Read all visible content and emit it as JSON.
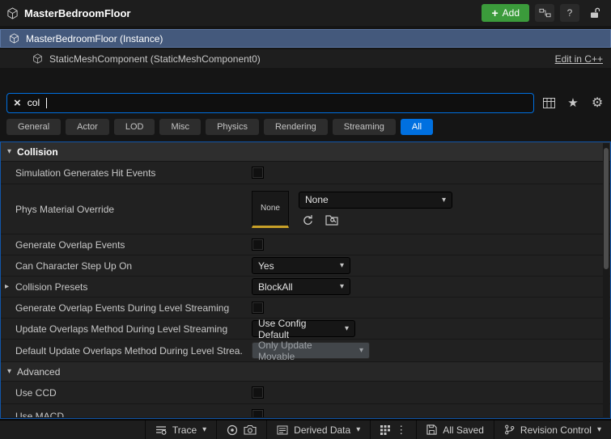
{
  "colors": {
    "accent_blue": "#0070e0",
    "add_green": "#3b9b3b",
    "selection_blue": "#44597c",
    "thumb_underline": "#c8a028"
  },
  "topbar": {
    "title": "MasterBedroomFloor",
    "add_label": "Add",
    "help_label": "?"
  },
  "tree": {
    "instance_label": "MasterBedroomFloor (Instance)",
    "component_label": "StaticMeshComponent (StaticMeshComponent0)",
    "edit_cpp_label": "Edit in C++"
  },
  "search": {
    "value": "col"
  },
  "tabs": {
    "items": [
      "General",
      "Actor",
      "LOD",
      "Misc",
      "Physics",
      "Rendering",
      "Streaming",
      "All"
    ],
    "active": "All"
  },
  "details": {
    "collision_header": "Collision",
    "advanced_header": "Advanced",
    "rows": [
      {
        "label": "Simulation Generates Hit Events",
        "control": "checkbox",
        "checked": false
      },
      {
        "label": "Phys Material Override",
        "control": "asset",
        "thumb_text": "None",
        "value": "None"
      },
      {
        "label": "Generate Overlap Events",
        "control": "checkbox",
        "checked": false
      },
      {
        "label": "Can Character Step Up On",
        "control": "dropdown",
        "value": "Yes"
      },
      {
        "label": "Collision Presets",
        "control": "dropdown",
        "value": "BlockAll"
      },
      {
        "label": "Generate Overlap Events During Level Streaming",
        "control": "checkbox",
        "checked": false
      },
      {
        "label": "Update Overlaps Method During Level Streaming",
        "control": "dropdown",
        "value": "Use Config Default"
      },
      {
        "label": "Default Update Overlaps Method During Level Strea...",
        "control": "dropdown",
        "value": "Only Update Movable",
        "disabled": true
      },
      {
        "label": "Use CCD",
        "control": "checkbox",
        "checked": false
      },
      {
        "label": "Use MACD",
        "control": "checkbox",
        "partial": true
      }
    ]
  },
  "statusbar": {
    "trace_label": "Trace",
    "derived_data_label": "Derived Data",
    "all_saved_label": "All Saved",
    "revision_control_label": "Revision Control"
  }
}
